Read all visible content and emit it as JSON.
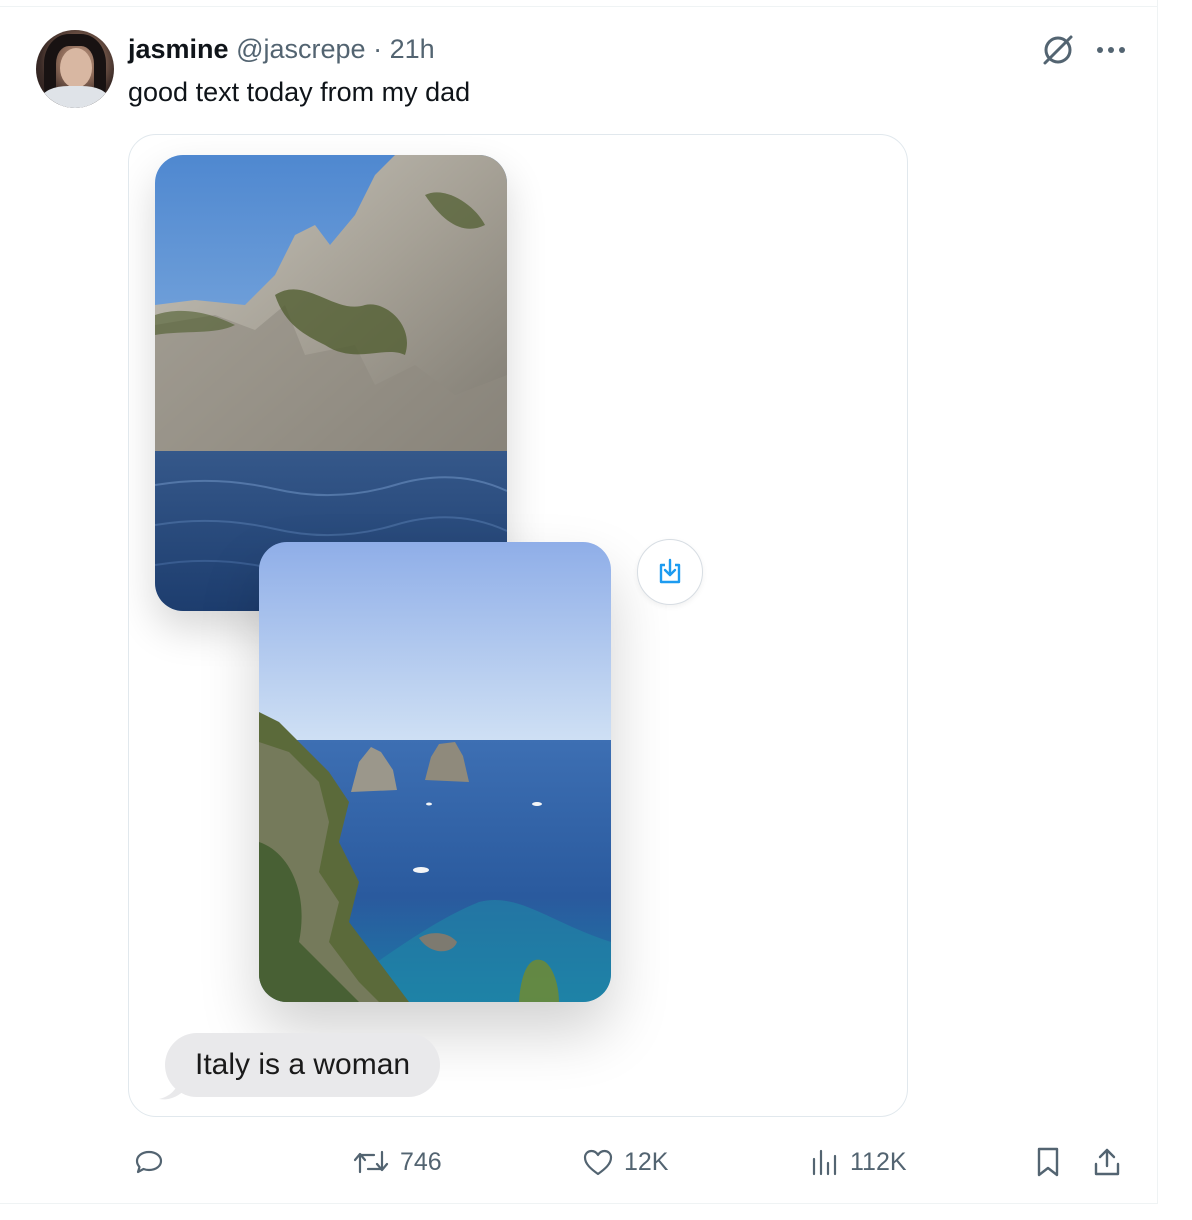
{
  "tweet": {
    "author_name": "jasmine",
    "author_handle": "@jascrepe",
    "separator": "·",
    "time": "21h",
    "text": "good text today from my dad"
  },
  "top_icons": [
    "grok-icon",
    "more-icon"
  ],
  "media": {
    "message_bubble_text": "Italy is a woman"
  },
  "actions": {
    "replies": "",
    "retweets": "746",
    "likes": "12K",
    "views": "112K"
  },
  "colors": {
    "secondary_text": "#536471",
    "bubble_bg": "#e9e9eb",
    "link_blue": "#1d9bf0"
  }
}
